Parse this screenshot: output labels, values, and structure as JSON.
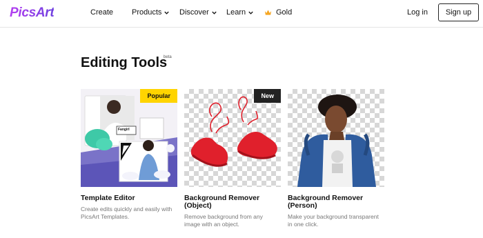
{
  "header": {
    "logo": "PicsArt",
    "nav": {
      "create": "Create",
      "products": "Products",
      "discover": "Discover",
      "learn": "Learn",
      "gold": "Gold"
    },
    "login": "Log in",
    "signup": "Sign up"
  },
  "section": {
    "title": "Editing Tools",
    "beta": "beta"
  },
  "cards": [
    {
      "title": "Template Editor",
      "description": "Create edits quickly and easily with PicsArt Templates.",
      "badge": "Popular",
      "thumb_text": "Fangirl"
    },
    {
      "title": "Background Remover (Object)",
      "description": "Remove background from any image with an object.",
      "badge": "New"
    },
    {
      "title": "Background Remover (Person)",
      "description": "Make your background transparent in one click."
    }
  ],
  "colors": {
    "brand_gradient_start": "#b43ff0",
    "brand_gradient_end": "#6e3fe0",
    "popular_badge": "#ffd400",
    "new_badge": "#222222",
    "gold_crown": "#f5a623",
    "sneaker_red": "#e0202c"
  }
}
